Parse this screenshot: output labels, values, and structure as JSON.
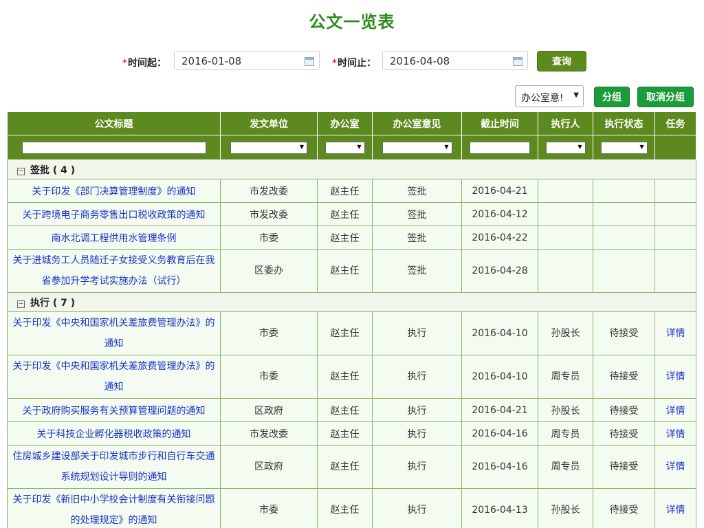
{
  "title": "公文一览表",
  "filters": {
    "start_label": "时间起：",
    "end_label": "时间止：",
    "required_mark": "*",
    "start_value": "2016-01-08",
    "end_value": "2016-04-08",
    "query_button": "查询",
    "group_field_selected": "办公室意!",
    "group_button": "分组",
    "ungroup_button": "取消分组"
  },
  "columns": [
    "公文标题",
    "发文单位",
    "办公室",
    "办公室意见",
    "截止时间",
    "执行人",
    "执行状态",
    "任务"
  ],
  "groups": [
    {
      "header": "签批 ( 4 )",
      "rows": [
        {
          "title": "关于印发《部门决算管理制度》的通知",
          "unit": "市发改委",
          "office": "赵主任",
          "opinion": "签批",
          "deadline": "2016-04-21",
          "executor": "",
          "status": "",
          "task": ""
        },
        {
          "title": "关于跨境电子商务零售出口税收政策的通知",
          "unit": "市发改委",
          "office": "赵主任",
          "opinion": "签批",
          "deadline": "2016-04-12",
          "executor": "",
          "status": "",
          "task": ""
        },
        {
          "title": "南水北调工程供用水管理条例",
          "unit": "市委",
          "office": "赵主任",
          "opinion": "签批",
          "deadline": "2016-04-22",
          "executor": "",
          "status": "",
          "task": ""
        },
        {
          "title": "关于进城务工人员随迁子女接受义务教育后在我省参加升学考试实施办法（试行）",
          "unit": "区委办",
          "office": "赵主任",
          "opinion": "签批",
          "deadline": "2016-04-28",
          "executor": "",
          "status": "",
          "task": ""
        }
      ]
    },
    {
      "header": "执行 ( 7 )",
      "rows": [
        {
          "title": "关于印发《中央和国家机关差旅费管理办法》的通知",
          "unit": "市委",
          "office": "赵主任",
          "opinion": "执行",
          "deadline": "2016-04-10",
          "executor": "孙股长",
          "status": "待接受",
          "task": "详情"
        },
        {
          "title": "关于印发《中央和国家机关差旅费管理办法》的通知",
          "unit": "市委",
          "office": "赵主任",
          "opinion": "执行",
          "deadline": "2016-04-10",
          "executor": "周专员",
          "status": "待接受",
          "task": "详情"
        },
        {
          "title": "关于政府购买服务有关预算管理问题的通知",
          "unit": "区政府",
          "office": "赵主任",
          "opinion": "执行",
          "deadline": "2016-04-21",
          "executor": "孙股长",
          "status": "待接受",
          "task": "详情"
        },
        {
          "title": "关于科技企业孵化器税收政策的通知",
          "unit": "市发改委",
          "office": "赵主任",
          "opinion": "执行",
          "deadline": "2016-04-16",
          "executor": "周专员",
          "status": "待接受",
          "task": "详情"
        },
        {
          "title": "住房城乡建设部关于印发城市步行和自行车交通系统规划设计导则的通知",
          "unit": "区政府",
          "office": "赵主任",
          "opinion": "执行",
          "deadline": "2016-04-16",
          "executor": "周专员",
          "status": "待接受",
          "task": "详情"
        },
        {
          "title": "关于印发《新旧中小学校会计制度有关衔接问题的处理规定》的通知",
          "unit": "市委",
          "office": "赵主任",
          "opinion": "执行",
          "deadline": "2016-04-13",
          "executor": "孙股长",
          "status": "待接受",
          "task": "详情"
        }
      ]
    }
  ],
  "colors": {
    "header_green": "#5d8a1f",
    "title_green": "#2e8b1e",
    "link_blue": "#1a33c9"
  }
}
